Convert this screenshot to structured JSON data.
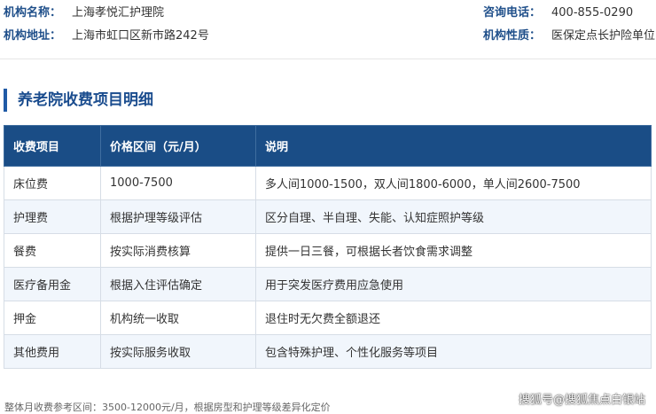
{
  "institution": {
    "name_label": "机构名称：",
    "name_value": "上海孝悦汇护理院",
    "address_label": "机构地址：",
    "address_value": "上海市虹口区新市路242号",
    "phone_label": "咨询电话：",
    "phone_value": "400-855-0290",
    "type_label": "机构性质：",
    "type_value": "医保定点长护险单位"
  },
  "section": {
    "title": "养老院收费项目明细"
  },
  "fee_table": {
    "headers": [
      "收费项目",
      "价格区间（元/月）",
      "说明"
    ],
    "rows": [
      [
        "床位费",
        "1000-7500",
        "多人间1000-1500，双人间1800-6000，单人间2600-7500"
      ],
      [
        "护理费",
        "根据护理等级评估",
        "区分自理、半自理、失能、认知症照护等级"
      ],
      [
        "餐费",
        "按实际消费核算",
        "提供一日三餐，可根据长者饮食需求调整"
      ],
      [
        "医疗备用金",
        "根据入住评估确定",
        "用于突发医疗费用应急使用"
      ],
      [
        "押金",
        "机构统一收取",
        "退住时无欠费全额退还"
      ],
      [
        "其他费用",
        "按实际服务收取",
        "包含特殊护理、个性化服务等项目"
      ]
    ]
  },
  "footnote": "整体月收费参考区间：3500-12000元/月，根据房型和护理等级差异化定价",
  "watermark": "搜狐号@搜狐焦点白银站",
  "colors": {
    "label_blue": "#1f4f8a",
    "header_bg": "#1a4d86",
    "accent_bar": "#1f5aa6",
    "row_alt": "#f1f6fc"
  }
}
